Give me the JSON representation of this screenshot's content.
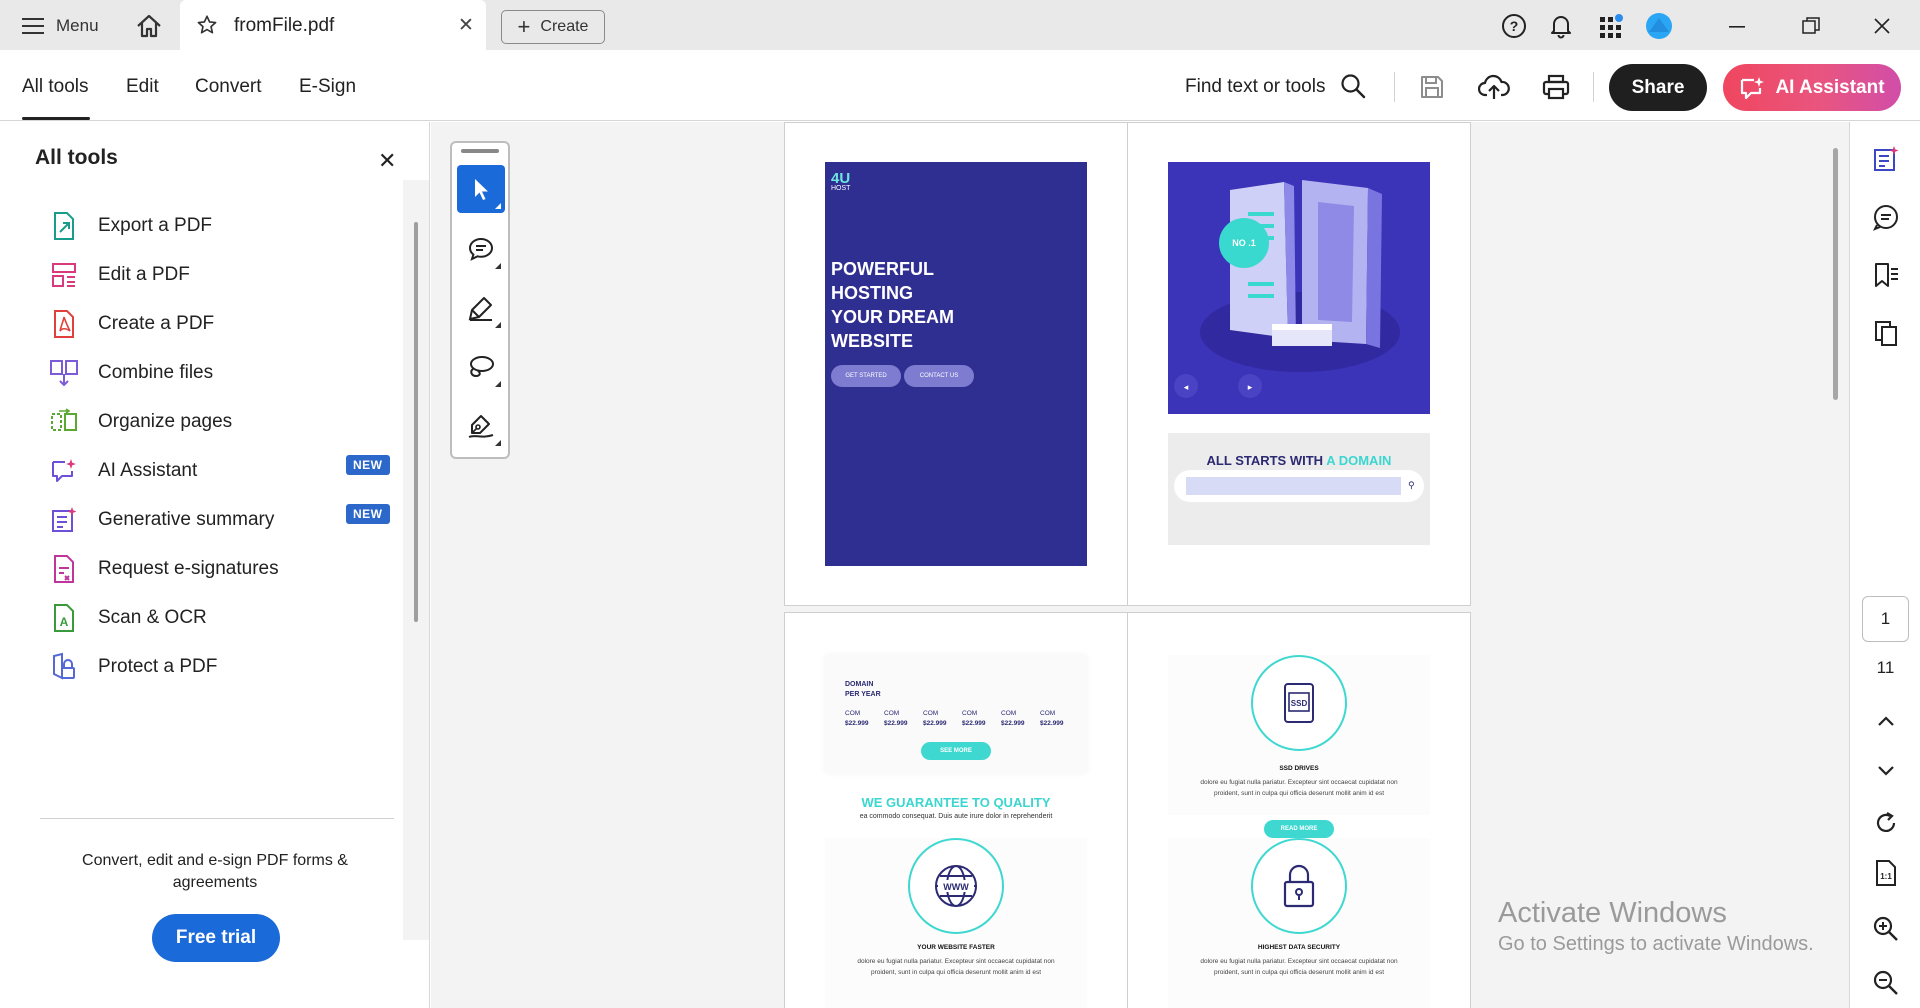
{
  "titlebar": {
    "menu_label": "Menu",
    "tab_title": "fromFile.pdf",
    "create_label": "Create"
  },
  "toolbar": {
    "nav": [
      "All tools",
      "Edit",
      "Convert",
      "E-Sign"
    ],
    "find_label": "Find text or tools",
    "share_label": "Share",
    "ai_label": "AI Assistant"
  },
  "left_panel": {
    "title": "All tools",
    "tools": [
      {
        "label": "Export a PDF",
        "icon": "export-pdf-icon",
        "badge": ""
      },
      {
        "label": "Edit a PDF",
        "icon": "edit-pdf-icon",
        "badge": ""
      },
      {
        "label": "Create a PDF",
        "icon": "create-pdf-icon",
        "badge": ""
      },
      {
        "label": "Combine files",
        "icon": "combine-files-icon",
        "badge": ""
      },
      {
        "label": "Organize pages",
        "icon": "organize-pages-icon",
        "badge": ""
      },
      {
        "label": "AI Assistant",
        "icon": "ai-assistant-icon",
        "badge": "NEW"
      },
      {
        "label": "Generative summary",
        "icon": "generative-summary-icon",
        "badge": "NEW"
      },
      {
        "label": "Request e-signatures",
        "icon": "request-esign-icon",
        "badge": ""
      },
      {
        "label": "Scan & OCR",
        "icon": "scan-ocr-icon",
        "badge": ""
      },
      {
        "label": "Protect a PDF",
        "icon": "protect-pdf-icon",
        "badge": ""
      }
    ],
    "promo_text": "Convert, edit and e-sign PDF forms & agreements",
    "trial_label": "Free trial"
  },
  "document": {
    "page1": {
      "logo": "4U",
      "logo_sub": "HOST",
      "headline": [
        "POWERFUL",
        "HOSTING",
        "YOUR DREAM",
        "WEBSITE"
      ],
      "btn1": "GET STARTED",
      "btn2": "CONTACT US"
    },
    "page2": {
      "badge": "NO .1",
      "domain_title": "ALL STARTS WITH",
      "domain_highlight": "A DOMAIN"
    },
    "page3": {
      "label1": "DOMAIN",
      "label2": "PER YEAR",
      "prices": [
        {
          "tld": "COM",
          "price": "$22.999"
        },
        {
          "tld": "COM",
          "price": "$22.999"
        },
        {
          "tld": "COM",
          "price": "$22.999"
        },
        {
          "tld": "COM",
          "price": "$22.999"
        },
        {
          "tld": "COM",
          "price": "$22.999"
        },
        {
          "tld": "COM",
          "price": "$22.999"
        }
      ],
      "see_more": "SEE MORE",
      "guarantee": "WE GUARANTEE TO",
      "guarantee_highlight": "QUALITY",
      "guarantee_sub": "ea commodo consequat. Duis aute irure dolor in reprehenderit",
      "feature_title": "YOUR WEBSITE FASTER",
      "feature_text_1": "dolore eu fugiat nulla pariatur. Excepteur sint occaecat cupidatat non",
      "feature_text_2": "proident, sunt in culpa qui officia deserunt mollit anim id est"
    },
    "page4": {
      "ssd_label": "SSD",
      "feature1_title": "SSD DRIVES",
      "feature1_text_1": "dolore eu fugiat nulla pariatur. Excepteur sint occaecat cupidatat non",
      "feature1_text_2": "proident, sunt in culpa qui officia deserunt mollit anim id est",
      "read_more": "READ MORE",
      "feature2_title": "HIGHEST DATA SECURITY",
      "feature2_text_1": "dolore eu fugiat nulla pariatur. Excepteur sint occaecat cupidatat non",
      "feature2_text_2": "proident, sunt in culpa qui officia deserunt mollit anim id est"
    }
  },
  "rail": {
    "current_page": "1",
    "total_pages": "11"
  },
  "watermark": {
    "title": "Activate Windows",
    "subtitle": "Go to Settings to activate Windows."
  },
  "colors": {
    "accent_blue": "#1b6ad9",
    "page_purple": "#2f2e91",
    "teal": "#3fd8d1"
  }
}
